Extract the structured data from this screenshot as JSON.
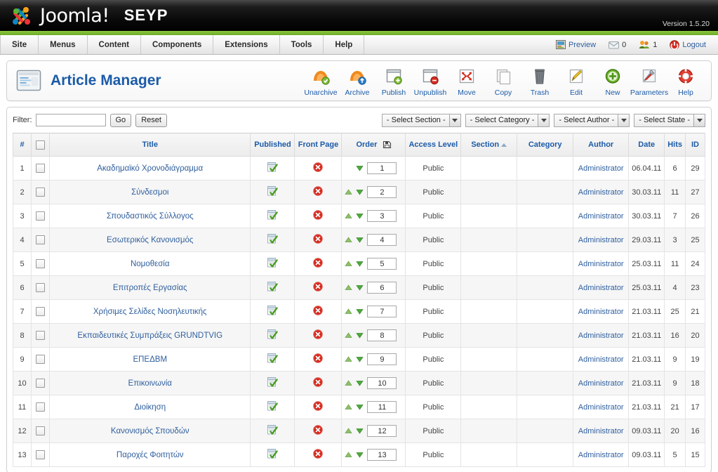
{
  "header": {
    "brand": "Joomla!",
    "site_name": "SEYP",
    "version": "Version 1.5.20",
    "preview_label": "Preview",
    "messages_count": "0",
    "users_count": "1",
    "logout_label": "Logout"
  },
  "menu": {
    "items": [
      {
        "label": "Site"
      },
      {
        "label": "Menus"
      },
      {
        "label": "Content"
      },
      {
        "label": "Components"
      },
      {
        "label": "Extensions"
      },
      {
        "label": "Tools"
      },
      {
        "label": "Help"
      }
    ]
  },
  "page": {
    "title": "Article Manager"
  },
  "toolbar": {
    "buttons": [
      {
        "label": "Unarchive",
        "icon": "unarchive-icon"
      },
      {
        "label": "Archive",
        "icon": "archive-icon"
      },
      {
        "label": "Publish",
        "icon": "publish-icon"
      },
      {
        "label": "Unpublish",
        "icon": "unpublish-icon"
      },
      {
        "label": "Move",
        "icon": "move-icon"
      },
      {
        "label": "Copy",
        "icon": "copy-icon"
      },
      {
        "label": "Trash",
        "icon": "trash-icon"
      },
      {
        "label": "Edit",
        "icon": "edit-icon"
      },
      {
        "label": "New",
        "icon": "new-icon"
      },
      {
        "label": "Parameters",
        "icon": "parameters-icon"
      },
      {
        "label": "Help",
        "icon": "help-icon"
      }
    ]
  },
  "filter": {
    "label": "Filter:",
    "value": "",
    "placeholder": "",
    "go_label": "Go",
    "reset_label": "Reset",
    "selects": [
      {
        "label": "- Select Section -"
      },
      {
        "label": "- Select Category -"
      },
      {
        "label": "- Select Author -"
      },
      {
        "label": "- Select State -"
      }
    ]
  },
  "table": {
    "columns": {
      "num": "#",
      "title": "Title",
      "published": "Published",
      "front_page": "Front Page",
      "order": "Order",
      "access_level": "Access Level",
      "section": "Section",
      "category": "Category",
      "author": "Author",
      "date": "Date",
      "hits": "Hits",
      "id": "ID"
    },
    "rows": [
      {
        "num": "1",
        "title": "Ακαδημαϊκό Χρονοδιάγραμμα",
        "published": true,
        "front_page": false,
        "order": "1",
        "up": false,
        "down": true,
        "access": "Public",
        "section": "",
        "category": "",
        "author": "Administrator",
        "date": "06.04.11",
        "hits": "6",
        "id": "29"
      },
      {
        "num": "2",
        "title": "Σύνδεσμοι",
        "published": true,
        "front_page": false,
        "order": "2",
        "up": true,
        "down": true,
        "access": "Public",
        "section": "",
        "category": "",
        "author": "Administrator",
        "date": "30.03.11",
        "hits": "11",
        "id": "27"
      },
      {
        "num": "3",
        "title": "Σπουδαστικός Σύλλογος",
        "published": true,
        "front_page": false,
        "order": "3",
        "up": true,
        "down": true,
        "access": "Public",
        "section": "",
        "category": "",
        "author": "Administrator",
        "date": "30.03.11",
        "hits": "7",
        "id": "26"
      },
      {
        "num": "4",
        "title": "Εσωτερικός Κανονισμός",
        "published": true,
        "front_page": false,
        "order": "4",
        "up": true,
        "down": true,
        "access": "Public",
        "section": "",
        "category": "",
        "author": "Administrator",
        "date": "29.03.11",
        "hits": "3",
        "id": "25"
      },
      {
        "num": "5",
        "title": "Νομοθεσία",
        "published": true,
        "front_page": false,
        "order": "5",
        "up": true,
        "down": true,
        "access": "Public",
        "section": "",
        "category": "",
        "author": "Administrator",
        "date": "25.03.11",
        "hits": "11",
        "id": "24"
      },
      {
        "num": "6",
        "title": "Επιτροπές Εργασίας",
        "published": true,
        "front_page": false,
        "order": "6",
        "up": true,
        "down": true,
        "access": "Public",
        "section": "",
        "category": "",
        "author": "Administrator",
        "date": "25.03.11",
        "hits": "4",
        "id": "23"
      },
      {
        "num": "7",
        "title": "Χρήσιμες Σελίδες Νοσηλευτικής",
        "published": true,
        "front_page": false,
        "order": "7",
        "up": true,
        "down": true,
        "access": "Public",
        "section": "",
        "category": "",
        "author": "Administrator",
        "date": "21.03.11",
        "hits": "25",
        "id": "21"
      },
      {
        "num": "8",
        "title": "Εκπαιδευτικές Συμπράξεις GRUNDTVIG",
        "published": true,
        "front_page": false,
        "order": "8",
        "up": true,
        "down": true,
        "access": "Public",
        "section": "",
        "category": "",
        "author": "Administrator",
        "date": "21.03.11",
        "hits": "16",
        "id": "20"
      },
      {
        "num": "9",
        "title": "ΕΠΕΔΒΜ",
        "published": true,
        "front_page": false,
        "order": "9",
        "up": true,
        "down": true,
        "access": "Public",
        "section": "",
        "category": "",
        "author": "Administrator",
        "date": "21.03.11",
        "hits": "9",
        "id": "19"
      },
      {
        "num": "10",
        "title": "Επικοινωνία",
        "published": true,
        "front_page": false,
        "order": "10",
        "up": true,
        "down": true,
        "access": "Public",
        "section": "",
        "category": "",
        "author": "Administrator",
        "date": "21.03.11",
        "hits": "9",
        "id": "18"
      },
      {
        "num": "11",
        "title": "Διοίκηση",
        "published": true,
        "front_page": false,
        "order": "11",
        "up": true,
        "down": true,
        "access": "Public",
        "section": "",
        "category": "",
        "author": "Administrator",
        "date": "21.03.11",
        "hits": "21",
        "id": "17"
      },
      {
        "num": "12",
        "title": "Κανονισμός Σπουδών",
        "published": true,
        "front_page": false,
        "order": "12",
        "up": true,
        "down": true,
        "access": "Public",
        "section": "",
        "category": "",
        "author": "Administrator",
        "date": "09.03.11",
        "hits": "20",
        "id": "16"
      },
      {
        "num": "13",
        "title": "Παροχές Φοιτητών",
        "published": true,
        "front_page": false,
        "order": "13",
        "up": true,
        "down": true,
        "access": "Public",
        "section": "",
        "category": "",
        "author": "Administrator",
        "date": "09.03.11",
        "hits": "5",
        "id": "15"
      }
    ]
  },
  "colors": {
    "brand_green": "#8cc63f",
    "link_blue": "#2f5f9e",
    "title_blue": "#1c5ba8",
    "access_green": "#2e8b2e",
    "status_red": "#d62b1f"
  }
}
